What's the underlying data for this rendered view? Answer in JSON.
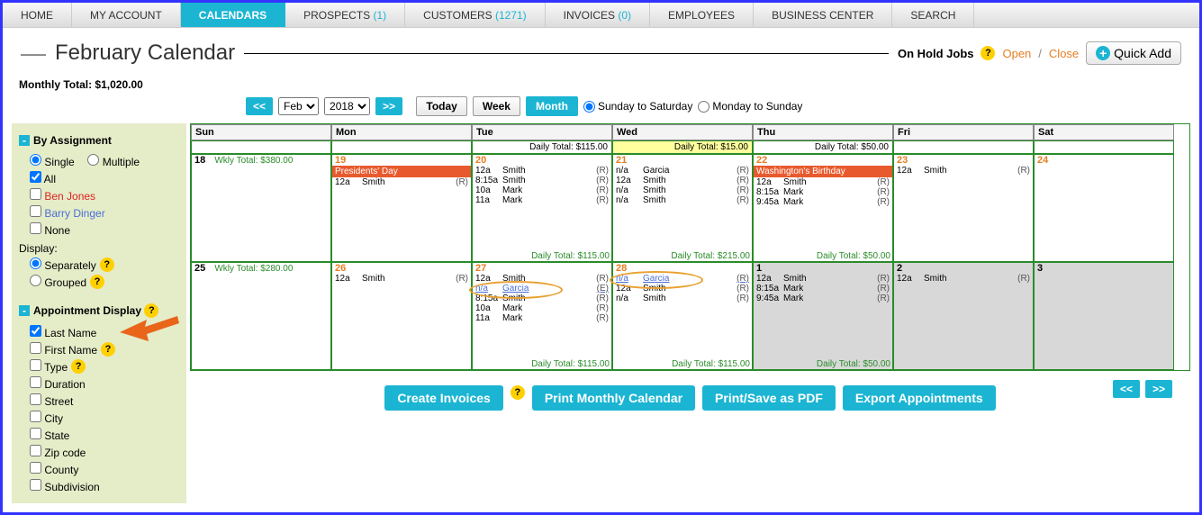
{
  "nav": {
    "home": "HOME",
    "myaccount": "MY ACCOUNT",
    "calendars": "CALENDARS",
    "prospects": "PROSPECTS",
    "prospects_count": "(1)",
    "customers": "CUSTOMERS",
    "customers_count": "(1271)",
    "invoices": "INVOICES",
    "invoices_count": "(0)",
    "employees": "EMPLOYEES",
    "business": "BUSINESS CENTER",
    "search": "SEARCH"
  },
  "header": {
    "title": "February Calendar",
    "onhold": "On Hold Jobs",
    "open": "Open",
    "close": "Close",
    "quickadd": "Quick Add"
  },
  "monthly_total": "Monthly Total: $1,020.00",
  "toolbar": {
    "prev": "<<",
    "next": ">>",
    "month_sel": "Feb",
    "year_sel": "2018",
    "today": "Today",
    "week": "Week",
    "month": "Month",
    "sun_sat": "Sunday to Saturday",
    "mon_sun": "Monday to Sunday"
  },
  "sidebar": {
    "by_assignment": "By Assignment",
    "single": "Single",
    "multiple": "Multiple",
    "all": "All",
    "ben": "Ben Jones",
    "barry": "Barry Dinger",
    "none": "None",
    "display": "Display:",
    "separately": "Separately",
    "grouped": "Grouped",
    "appt_display": "Appointment Display",
    "opts": [
      "Last Name",
      "First Name",
      "Type",
      "Duration",
      "Street",
      "City",
      "State",
      "Zip code",
      "County",
      "Subdivision"
    ]
  },
  "cal": {
    "days": [
      "Sun",
      "Mon",
      "Tue",
      "Wed",
      "Thu",
      "Fri",
      "Sat"
    ],
    "top_totals": [
      "",
      "",
      "Daily Total: $115.00",
      "Daily Total: $15.00",
      "Daily Total: $50.00",
      "",
      ""
    ],
    "week1": {
      "sun": {
        "num": "18",
        "wkly": "Wkly Total: $380.00"
      },
      "mon": {
        "num": "19",
        "holiday": "Presidents' Day",
        "appts": [
          {
            "t": "12a",
            "n": "Smith",
            "r": "(R)"
          }
        ]
      },
      "tue": {
        "num": "20",
        "appts": [
          {
            "t": "12a",
            "n": "Smith",
            "r": "(R)"
          },
          {
            "t": "8:15a",
            "n": "Smith",
            "r": "(R)"
          },
          {
            "t": "10a",
            "n": "Mark",
            "r": "(R)"
          },
          {
            "t": "11a",
            "n": "Mark",
            "r": "(R)"
          }
        ],
        "total": "Daily Total: $115.00"
      },
      "wed": {
        "num": "21",
        "appts": [
          {
            "t": "n/a",
            "n": "Garcia",
            "r": "(R)"
          },
          {
            "t": "12a",
            "n": "Smith",
            "r": "(R)"
          },
          {
            "t": "n/a",
            "n": "Smith",
            "r": "(R)"
          },
          {
            "t": "n/a",
            "n": "Smith",
            "r": "(R)"
          }
        ],
        "total": "Daily Total: $215.00"
      },
      "thu": {
        "num": "22",
        "holiday": "Washington's Birthday",
        "appts": [
          {
            "t": "12a",
            "n": "Smith",
            "r": "(R)"
          },
          {
            "t": "8:15a",
            "n": "Mark",
            "r": "(R)"
          },
          {
            "t": "9:45a",
            "n": "Mark",
            "r": "(R)"
          }
        ],
        "total": "Daily Total: $50.00"
      },
      "fri": {
        "num": "23",
        "appts": [
          {
            "t": "12a",
            "n": "Smith",
            "r": "(R)"
          }
        ]
      },
      "sat": {
        "num": "24"
      }
    },
    "week2": {
      "sun": {
        "num": "25",
        "wkly": "Wkly Total: $280.00"
      },
      "mon": {
        "num": "26",
        "appts": [
          {
            "t": "12a",
            "n": "Smith",
            "r": "(R)"
          }
        ]
      },
      "tue": {
        "num": "27",
        "appts": [
          {
            "t": "12a",
            "n": "Smith",
            "r": "(R)"
          },
          {
            "t": "n/a",
            "n": "Garcia",
            "r": "(E)",
            "circled": true,
            "link": true
          },
          {
            "t": "8:15a",
            "n": "Smith",
            "r": "(R)"
          },
          {
            "t": "10a",
            "n": "Mark",
            "r": "(R)"
          },
          {
            "t": "11a",
            "n": "Mark",
            "r": "(R)"
          }
        ],
        "total": "Daily Total: $115.00"
      },
      "wed": {
        "num": "28",
        "appts": [
          {
            "t": "n/a",
            "n": "Garcia",
            "r": "(R)",
            "circled": true,
            "link": true
          },
          {
            "t": "12a",
            "n": "Smith",
            "r": "(R)"
          },
          {
            "t": "n/a",
            "n": "Smith",
            "r": "(R)"
          }
        ],
        "total": "Daily Total: $115.00"
      },
      "thu": {
        "num": "1",
        "grey": true,
        "appts": [
          {
            "t": "12a",
            "n": "Smith",
            "r": "(R)"
          },
          {
            "t": "8:15a",
            "n": "Mark",
            "r": "(R)"
          },
          {
            "t": "9:45a",
            "n": "Mark",
            "r": "(R)"
          }
        ],
        "total": "Daily Total: $50.00"
      },
      "fri": {
        "num": "2",
        "grey": true,
        "appts": [
          {
            "t": "12a",
            "n": "Smith",
            "r": "(R)"
          }
        ]
      },
      "sat": {
        "num": "3",
        "grey": true
      }
    }
  },
  "footer": {
    "create": "Create Invoices",
    "print_month": "Print Monthly Calendar",
    "print_pdf": "Print/Save as PDF",
    "export": "Export Appointments",
    "prev": "<<",
    "next": ">>"
  }
}
